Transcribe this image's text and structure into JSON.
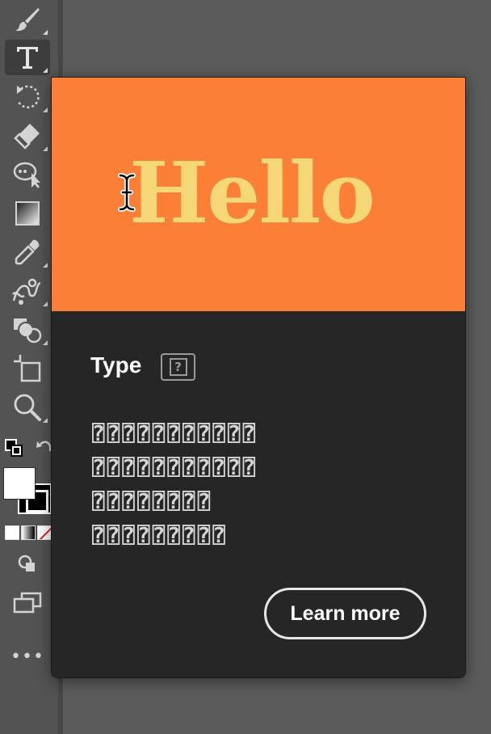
{
  "toolbar": {
    "tools": [
      {
        "name": "paintbrush-tool",
        "icon": "paintbrush-icon"
      },
      {
        "name": "type-tool",
        "icon": "type-icon",
        "active": true
      },
      {
        "name": "rotate-tool",
        "icon": "rotate-icon"
      },
      {
        "name": "eraser-tool",
        "icon": "eraser-icon"
      },
      {
        "name": "puppet-warp-tool",
        "icon": "puppet-warp-icon"
      },
      {
        "name": "gradient-tool",
        "icon": "gradient-icon"
      },
      {
        "name": "eyedropper-tool",
        "icon": "eyedropper-icon"
      },
      {
        "name": "blend-tool",
        "icon": "blend-icon"
      },
      {
        "name": "shape-builder-tool",
        "icon": "shape-builder-icon"
      },
      {
        "name": "artboard-tool",
        "icon": "artboard-icon"
      },
      {
        "name": "zoom-tool",
        "icon": "magnifier-icon"
      }
    ],
    "fill_color": "#ffffff",
    "stroke_color": "#000000",
    "more_label": "•••"
  },
  "popup": {
    "hero_text": "Hello",
    "hero_bg": "#fb7f37",
    "hero_text_color": "#f6d777",
    "title": "Type",
    "title_badge": "?",
    "description_lines": [
      "⍰⍰⍰⍰⍰⍰⍰⍰⍰⍰⍰",
      "⍰⍰⍰⍰⍰⍰⍰⍰⍰⍰⍰",
      "⍰⍰⍰⍰⍰⍰⍰⍰",
      "⍰⍰⍰⍰⍰⍰⍰⍰⍰"
    ],
    "learn_more_label": "Learn more"
  }
}
